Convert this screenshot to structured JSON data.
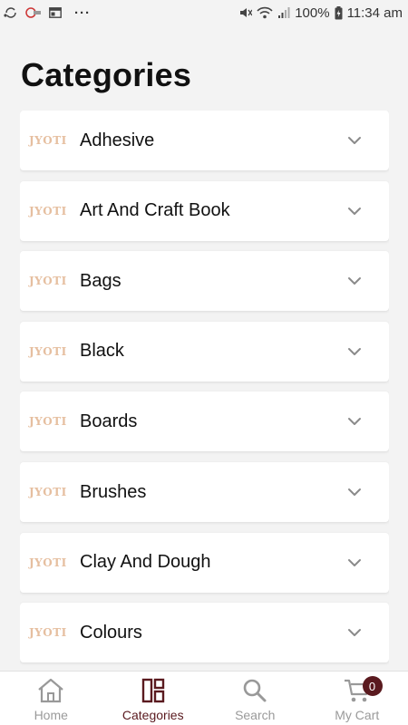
{
  "status_bar": {
    "battery": "100%",
    "time": "11:34 am",
    "more": "···"
  },
  "page": {
    "title": "Categories"
  },
  "categories": [
    {
      "logo": "JYOTI",
      "name": "Adhesive"
    },
    {
      "logo": "JYOTI",
      "name": "Art And Craft Book"
    },
    {
      "logo": "JYOTI",
      "name": "Bags"
    },
    {
      "logo": "JYOTI",
      "name": "Black"
    },
    {
      "logo": "JYOTI",
      "name": "Boards"
    },
    {
      "logo": "JYOTI",
      "name": "Brushes"
    },
    {
      "logo": "JYOTI",
      "name": "Clay And Dough"
    },
    {
      "logo": "JYOTI",
      "name": "Colours"
    }
  ],
  "bottom_nav": {
    "items": [
      {
        "label": "Home",
        "icon": "home-icon"
      },
      {
        "label": "Categories",
        "icon": "categories-icon",
        "active": true
      },
      {
        "label": "Search",
        "icon": "search-icon"
      },
      {
        "label": "My Cart",
        "icon": "cart-icon",
        "badge": "0"
      }
    ]
  },
  "colors": {
    "accent": "#5a1a1f",
    "logo": "#e6bfa0",
    "background": "#f3f3f3"
  }
}
